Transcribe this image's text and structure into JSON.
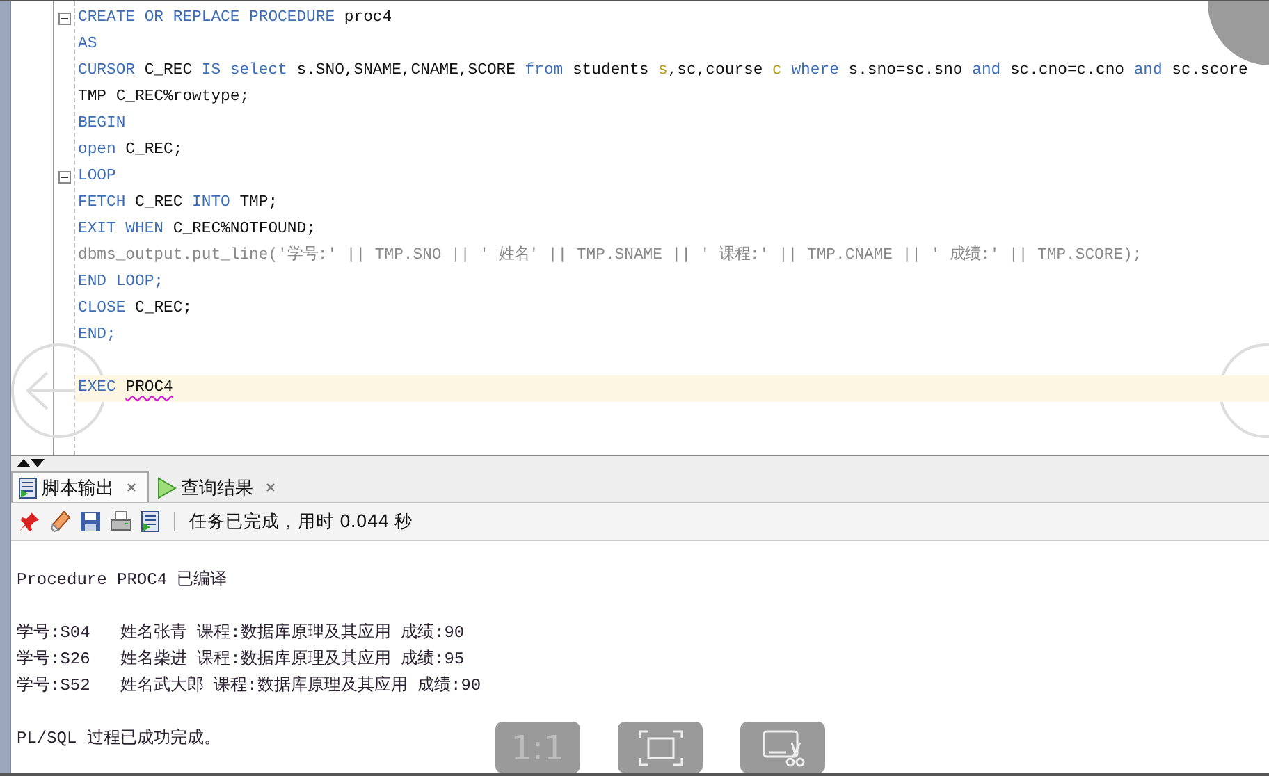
{
  "editor": {
    "lines": [
      {
        "kind": "code",
        "fold": true,
        "highlighted": false,
        "tokens": [
          {
            "text": "CREATE OR REPLACE PROCEDURE",
            "kind": "keyword"
          },
          {
            "text": " proc4",
            "kind": "plain"
          }
        ]
      },
      {
        "kind": "code",
        "fold": false,
        "highlighted": false,
        "tokens": [
          {
            "text": "AS",
            "kind": "keyword"
          }
        ]
      },
      {
        "kind": "code",
        "fold": false,
        "highlighted": false,
        "tokens": [
          {
            "text": "CURSOR",
            "kind": "keyword"
          },
          {
            "text": " C_REC ",
            "kind": "plain"
          },
          {
            "text": "IS select",
            "kind": "keyword"
          },
          {
            "text": " s.SNO,SNAME,CNAME,SCORE ",
            "kind": "plain"
          },
          {
            "text": "from",
            "kind": "keyword"
          },
          {
            "text": " students ",
            "kind": "plain"
          },
          {
            "text": "s",
            "kind": "alias"
          },
          {
            "text": ",sc,course ",
            "kind": "plain"
          },
          {
            "text": "c",
            "kind": "alias"
          },
          {
            "text": " where",
            "kind": "keyword"
          },
          {
            "text": " s.sno=sc.sno ",
            "kind": "plain"
          },
          {
            "text": "and",
            "kind": "keyword"
          },
          {
            "text": " sc.cno=c.cno ",
            "kind": "plain"
          },
          {
            "text": "and",
            "kind": "keyword"
          },
          {
            "text": " sc.score",
            "kind": "plain"
          }
        ]
      },
      {
        "kind": "code",
        "fold": false,
        "highlighted": false,
        "tokens": [
          {
            "text": "TMP C_REC%rowtype;",
            "kind": "plain"
          }
        ]
      },
      {
        "kind": "code",
        "fold": false,
        "highlighted": false,
        "tokens": [
          {
            "text": "BEGIN",
            "kind": "keyword"
          }
        ]
      },
      {
        "kind": "code",
        "fold": false,
        "highlighted": false,
        "tokens": [
          {
            "text": "open",
            "kind": "keyword"
          },
          {
            "text": " C_REC;",
            "kind": "plain"
          }
        ]
      },
      {
        "kind": "code",
        "fold": true,
        "highlighted": false,
        "tokens": [
          {
            "text": "LOOP",
            "kind": "keyword"
          }
        ]
      },
      {
        "kind": "code",
        "fold": false,
        "highlighted": false,
        "tokens": [
          {
            "text": "FETCH",
            "kind": "keyword"
          },
          {
            "text": " C_REC ",
            "kind": "plain"
          },
          {
            "text": "INTO",
            "kind": "keyword"
          },
          {
            "text": " TMP;",
            "kind": "plain"
          }
        ]
      },
      {
        "kind": "code",
        "fold": false,
        "highlighted": false,
        "tokens": [
          {
            "text": "EXIT WHEN",
            "kind": "keyword"
          },
          {
            "text": " C_REC%NOTFOUND;",
            "kind": "plain"
          }
        ]
      },
      {
        "kind": "code",
        "fold": false,
        "highlighted": false,
        "tokens": [
          {
            "text": "dbms_output.put_line('学号:' || TMP.SNO || ' 姓名' || TMP.SNAME || ' 课程:' || TMP.CNAME || ' 成绩:' || TMP.SCORE);",
            "kind": "builtin"
          }
        ]
      },
      {
        "kind": "code",
        "fold": false,
        "highlighted": false,
        "tokens": [
          {
            "text": "END LOOP;",
            "kind": "keyword"
          }
        ]
      },
      {
        "kind": "code",
        "fold": false,
        "highlighted": false,
        "tokens": [
          {
            "text": "CLOSE",
            "kind": "keyword"
          },
          {
            "text": " C_REC;",
            "kind": "plain"
          }
        ]
      },
      {
        "kind": "code",
        "fold": false,
        "highlighted": false,
        "tokens": [
          {
            "text": "END;",
            "kind": "keyword"
          }
        ]
      },
      {
        "kind": "blank"
      },
      {
        "kind": "code",
        "fold": false,
        "highlighted": true,
        "tokens": [
          {
            "text": "EXEC ",
            "kind": "keyword"
          },
          {
            "text": "PROC4",
            "kind": "flagged"
          }
        ]
      }
    ]
  },
  "output_panel": {
    "tabs": [
      {
        "label": "脚本输出",
        "selected": true,
        "kind": "script"
      },
      {
        "label": "查询结果",
        "selected": false,
        "kind": "run"
      }
    ],
    "status": "任务已完成，用时 0.044 秒",
    "lines": [
      {
        "kind": "blank"
      },
      {
        "kind": "text",
        "text": "Procedure PROC4 已编译"
      },
      {
        "kind": "blank"
      },
      {
        "kind": "text",
        "text": "学号:S04   姓名张青 课程:数据库原理及其应用 成绩:90"
      },
      {
        "kind": "text",
        "text": "学号:S26   姓名柴进 课程:数据库原理及其应用 成绩:95"
      },
      {
        "kind": "text",
        "text": "学号:S52   姓名武大郎 课程:数据库原理及其应用 成绩:90"
      },
      {
        "kind": "blank"
      },
      {
        "kind": "text",
        "text": "PL/SQL 过程已成功完成。"
      }
    ]
  },
  "viewer_controls": {
    "buttons": [
      {
        "kind": "actual_size",
        "label": "1:1"
      },
      {
        "kind": "fit"
      },
      {
        "kind": "crop"
      }
    ]
  }
}
